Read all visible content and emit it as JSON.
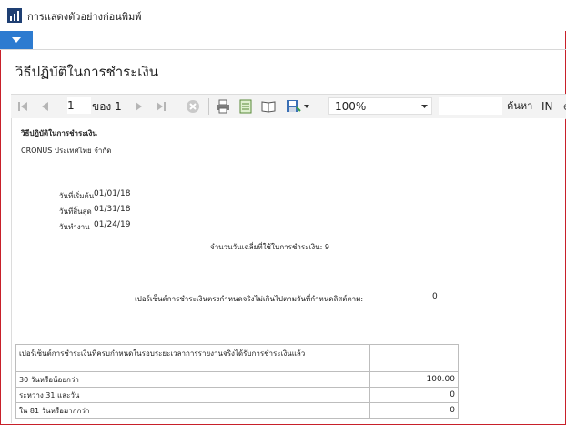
{
  "window": {
    "title": "การแสดงตัวอย่างก่อนพิมพ์"
  },
  "page": {
    "title": "วิธีปฏิบัติในการชำระเงิน"
  },
  "toolbar": {
    "page_number": "1",
    "of_label": "ของ 1",
    "zoom": "100%",
    "find_label": "ค้นหา",
    "find_in": "IN",
    "find_extra": "e"
  },
  "report": {
    "title": "วิธีปฏิบัติในการชำระเงิน",
    "company": "CRONUS ประเทศไทย จำกัด",
    "fields": [
      {
        "label": "วันที่เริ่มต้น",
        "value": "01/01/18"
      },
      {
        "label": "วันที่สิ้นสุด",
        "value": "01/31/18"
      },
      {
        "label": "วันทำงาน",
        "value": "01/24/19"
      }
    ],
    "avg_days_label": "จำนวนวันเฉลี่ยที่ใช้ในการชำระเงิน: 9",
    "unpaid_label": "เปอร์เซ็นต์การชำระเงินตรงกำหนดจริงไม่เกินไปตามวันที่กำหนดลิสต์ตาม:",
    "unpaid_value": "0",
    "table_header": "เปอร์เซ็นต์การชำระเงินที่ครบกำหนดในรอบระยะเวลาการรายงานจริงได้รับการชำระเงินแล้ว",
    "rows": [
      {
        "label": "30 วันหรือน้อยกว่า",
        "value": "100.00"
      },
      {
        "label": "ระหว่าง 31 และวัน",
        "value": "0"
      },
      {
        "label": "ใน 81 วันหรือมากกว่า",
        "value": "0"
      }
    ]
  }
}
